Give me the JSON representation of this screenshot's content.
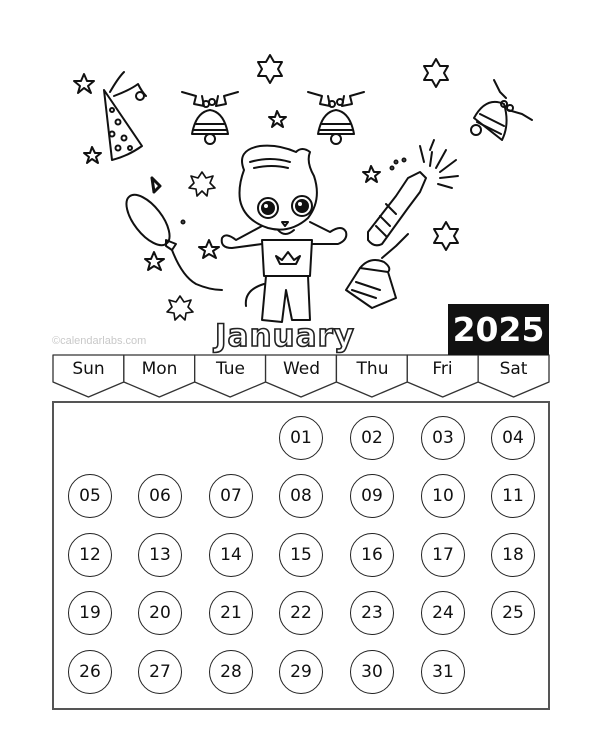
{
  "calendar": {
    "watermark": "©calendarlabs.com",
    "month": "January",
    "year": "2025",
    "weekdays": [
      "Sun",
      "Mon",
      "Tue",
      "Wed",
      "Thu",
      "Fri",
      "Sat"
    ],
    "first_weekday_index": 3,
    "days": [
      "01",
      "02",
      "03",
      "04",
      "05",
      "06",
      "07",
      "08",
      "09",
      "10",
      "11",
      "12",
      "13",
      "14",
      "15",
      "16",
      "17",
      "18",
      "19",
      "20",
      "21",
      "22",
      "23",
      "24",
      "25",
      "26",
      "27",
      "28",
      "29",
      "30",
      "31"
    ]
  },
  "illustration": {
    "theme": "new-year-coloring-page",
    "items": [
      "party-hat-icon",
      "bell-icon",
      "bell-icon",
      "bell-icon",
      "champagne-bottle-icon",
      "balloon-icon",
      "music-note-icon",
      "cupcake-icon",
      "cartoon-cat-character",
      "star-icon",
      "snowflake-icon"
    ]
  },
  "colors": {
    "ink": "#111111",
    "year_bg": "#111111",
    "year_text": "#ffffff",
    "watermark": "#c9c9c9"
  }
}
